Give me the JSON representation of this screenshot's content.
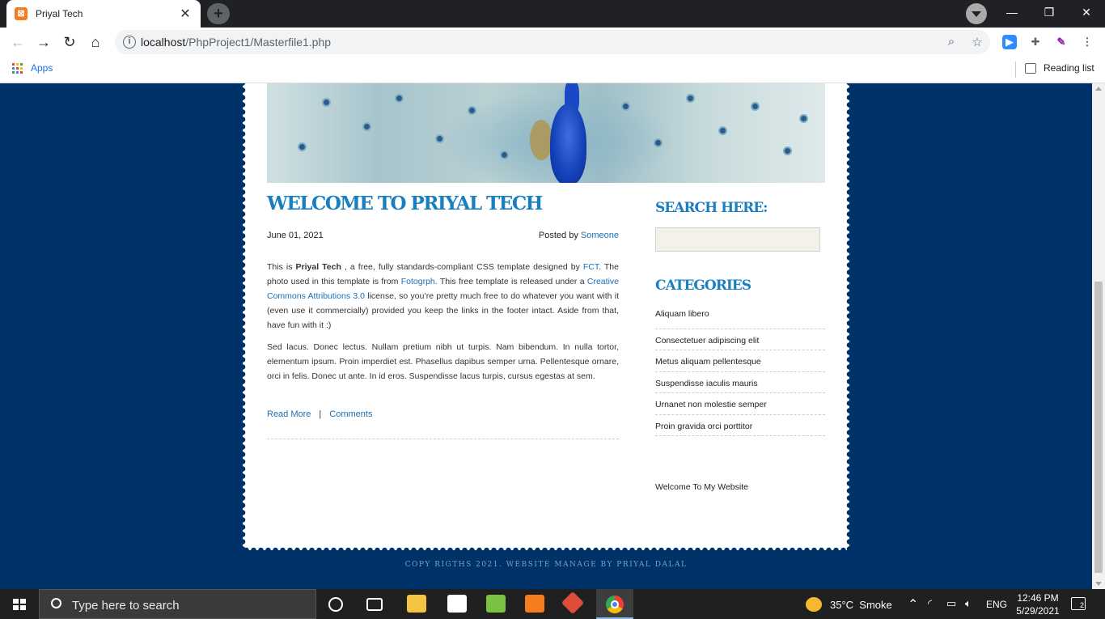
{
  "browser": {
    "tab_title": "Priyal Tech",
    "favicon_text": "⊠",
    "url_host": "localhost",
    "url_path": "/PhpProject1/Masterfile1.php",
    "bookmarks_apps": "Apps",
    "reading_list": "Reading list"
  },
  "page": {
    "post_title": "WELCOME TO PRIYAL TECH",
    "date": "June 01, 2021",
    "posted_by_prefix": "Posted by ",
    "posted_by_author": "Someone",
    "p1": {
      "a": "This is ",
      "brand": "Priyal Tech",
      "b": " , a free, fully standards-compliant CSS template designed by ",
      "fct": "FCT",
      "c": ". The photo used in this template is from ",
      "fotogrph": "Fotogrph",
      "d": ". This free template is released under a ",
      "license": "Creative Commons Attributions 3.0",
      "e": " license, so you’re pretty much free to do whatever you want with it (even use it commercially) provided you keep the links in the footer intact. Aside from that, have fun with it :)"
    },
    "p2": "Sed lacus. Donec lectus. Nullam pretium nibh ut turpis. Nam bibendum. In nulla tortor, elementum ipsum. Proin imperdiet est. Phasellus dapibus semper urna. Pellentesque ornare, orci in felis. Donec ut ante. In id eros. Suspendisse lacus turpis, cursus egestas at sem.",
    "read_more": "Read More",
    "link_sep": "|",
    "comments": "Comments",
    "search_title": "SEARCH HERE:",
    "search_value": "",
    "categories_title": "CATEGORIES",
    "categories": [
      "Aliquam libero",
      "Consectetuer adipiscing elit",
      "Metus aliquam pellentesque",
      "Suspendisse iaculis mauris",
      "Urnanet non molestie semper",
      "Proin gravida orci porttitor"
    ],
    "welcome": "Welcome To My Website",
    "footer": "COPY RIGTHS 2021. WEBSITE MANAGE BY PRIYAL DALAL"
  },
  "taskbar": {
    "search_placeholder": "Type here to search",
    "weather": "35°C  Smoke",
    "language": "ENG",
    "time": "12:46 PM",
    "date": "5/29/2021",
    "notifications": "2"
  },
  "colors": {
    "page_bg": "#00326a",
    "link": "#1a6fb5",
    "heading": "#1a7fbf"
  }
}
